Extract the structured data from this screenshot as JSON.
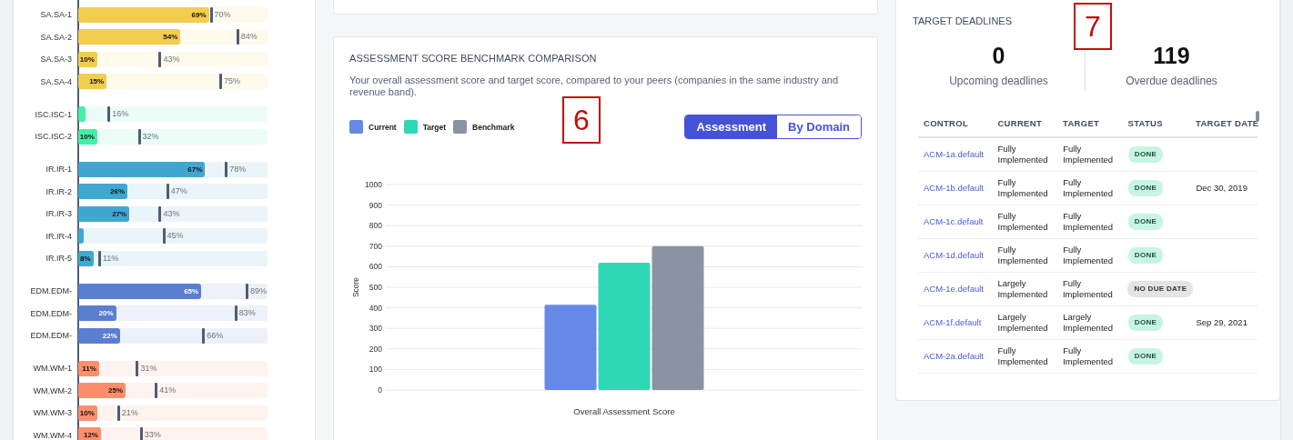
{
  "domain_scores": {
    "groups": [
      {
        "color": "#f2cd4e",
        "rows": [
          {
            "label": "SA.SA-1",
            "current": {
              "level": 0.69,
              "text": "69%"
            },
            "target": {
              "level": 0.7,
              "text": "70%"
            }
          },
          {
            "label": "SA.SA-2",
            "current": {
              "level": 0.54,
              "text": "54%"
            },
            "target": {
              "level": 0.84,
              "text": "84%"
            }
          },
          {
            "label": "SA.SA-3",
            "current": {
              "level": 0.1,
              "text": "10%"
            },
            "target": {
              "level": 0.43,
              "text": "43%"
            }
          },
          {
            "label": "SA.SA-4",
            "current": {
              "level": 0.15,
              "text": "15%"
            },
            "target": {
              "level": 0.75,
              "text": "75%"
            }
          }
        ]
      },
      {
        "color": "#45efa9",
        "rows": [
          {
            "label": "ISC.ISC-1",
            "current": {
              "level": 0.04
            },
            "target": {
              "level": 0.16,
              "text": "16%"
            }
          },
          {
            "label": "ISC.ISC-2",
            "current": {
              "level": 0.1,
              "text": "10%"
            },
            "target": {
              "level": 0.32,
              "text": "32%"
            }
          }
        ]
      },
      {
        "color": "#40a7d0",
        "rows": [
          {
            "label": "IR.IR-1",
            "current": {
              "level": 0.67,
              "text": "67%"
            },
            "target": {
              "level": 0.78,
              "text": "78%"
            }
          },
          {
            "label": "IR.IR-2",
            "current": {
              "level": 0.26,
              "text": "26%"
            },
            "target": {
              "level": 0.47,
              "text": "47%"
            }
          },
          {
            "label": "IR.IR-3",
            "current": {
              "level": 0.27,
              "text": "27%"
            },
            "target": {
              "level": 0.43,
              "text": "43%"
            }
          },
          {
            "label": "IR.IR-4",
            "current": {
              "level": 0.03
            },
            "target": {
              "level": 0.45,
              "text": "45%"
            }
          },
          {
            "label": "IR.IR-5",
            "current": {
              "level": 0.08,
              "text": "8%"
            },
            "target": {
              "level": 0.11,
              "text": "11%"
            }
          }
        ]
      },
      {
        "color": "#5a7fd0",
        "rows": [
          {
            "label": "EDM.EDM-",
            "current": {
              "level": 0.65,
              "text": "65%"
            },
            "target": {
              "level": 0.89,
              "text": "89%"
            }
          },
          {
            "label": "EDM.EDM-",
            "current": {
              "level": 0.2,
              "text": "20%"
            },
            "target": {
              "level": 0.83,
              "text": "83%"
            }
          },
          {
            "label": "EDM.EDM-",
            "current": {
              "level": 0.22,
              "text": "22%"
            },
            "target": {
              "level": 0.66,
              "text": "66%"
            }
          }
        ]
      },
      {
        "color": "#fd8e6c",
        "rows": [
          {
            "label": "WM.WM-1",
            "current": {
              "level": 0.11,
              "text": "11%"
            },
            "target": {
              "level": 0.31,
              "text": "31%"
            }
          },
          {
            "label": "WM.WM-2",
            "current": {
              "level": 0.25,
              "text": "25%"
            },
            "target": {
              "level": 0.41,
              "text": "41%"
            }
          },
          {
            "label": "WM.WM-3",
            "current": {
              "level": 0.1,
              "text": "10%"
            },
            "target": {
              "level": 0.21,
              "text": "21%"
            }
          },
          {
            "label": "WM.WM-4",
            "current": {
              "level": 0.12,
              "text": "12%"
            },
            "target": {
              "level": 0.33,
              "text": "33%"
            }
          }
        ]
      }
    ]
  },
  "benchmark": {
    "title": "ASSESSMENT SCORE BENCHMARK COMPARISON",
    "description": "Your overall assessment score and target score, compared to your peers (companies in the same industry and revenue band).",
    "toggle": [
      {
        "label": "Assessment",
        "selected": true
      },
      {
        "label": "By Domain",
        "selected": false
      }
    ],
    "chart_data": {
      "type": "bar",
      "ylabel": "Score",
      "categories": [
        "Overall Assessment Score"
      ],
      "series": [
        {
          "name": "Current",
          "color": "#6689e8",
          "values": [
            415
          ]
        },
        {
          "name": "Target",
          "color": "#2fd8b4",
          "values": [
            620
          ]
        },
        {
          "name": "Benchmark",
          "color": "#8a93a3",
          "values": [
            700
          ]
        }
      ],
      "grid": true,
      "ylim": [
        0,
        1000
      ],
      "yticks": [
        0,
        100,
        200,
        300,
        400,
        500,
        600,
        700,
        800,
        900,
        1000
      ]
    }
  },
  "target_deadlines": {
    "title": "TARGET DEADLINES",
    "stats": [
      {
        "value": "0",
        "label": "Upcoming deadlines"
      },
      {
        "value": "119",
        "label": "Overdue deadlines"
      }
    ],
    "table": {
      "columns": [
        "CONTROL",
        "CURRENT",
        "TARGET",
        "STATUS",
        "TARGET DATE"
      ],
      "rows": [
        {
          "control": "ACM-1a.default",
          "current": "Fully Implemented",
          "target": "Fully Implemented",
          "status": {
            "text": "DONE",
            "kind": "done"
          }
        },
        {
          "control": "ACM-1b.default",
          "current": "Fully Implemented",
          "target": "Fully Implemented",
          "status": {
            "text": "DONE",
            "kind": "done"
          },
          "target_date": "Dec 30, 2019"
        },
        {
          "control": "ACM-1c.default",
          "current": "Fully Implemented",
          "target": "Fully Implemented",
          "status": {
            "text": "DONE",
            "kind": "done"
          }
        },
        {
          "control": "ACM-1d.default",
          "current": "Fully Implemented",
          "target": "Fully Implemented",
          "status": {
            "text": "DONE",
            "kind": "done"
          }
        },
        {
          "control": "ACM-1e.default",
          "current": "Largely Implemented",
          "target": "Fully Implemented",
          "status": {
            "text": "NO DUE DATE",
            "kind": "none"
          }
        },
        {
          "control": "ACM-1f.default",
          "current": "Largely Implemented",
          "target": "Largely Implemented",
          "status": {
            "text": "DONE",
            "kind": "done"
          },
          "target_date": "Sep 29, 2021"
        },
        {
          "control": "ACM-2a.default",
          "current": "Fully Implemented",
          "target": "Fully Implemented",
          "status": {
            "text": "DONE",
            "kind": "done"
          }
        }
      ]
    }
  },
  "callouts": [
    {
      "text": "6"
    },
    {
      "text": "7"
    }
  ]
}
